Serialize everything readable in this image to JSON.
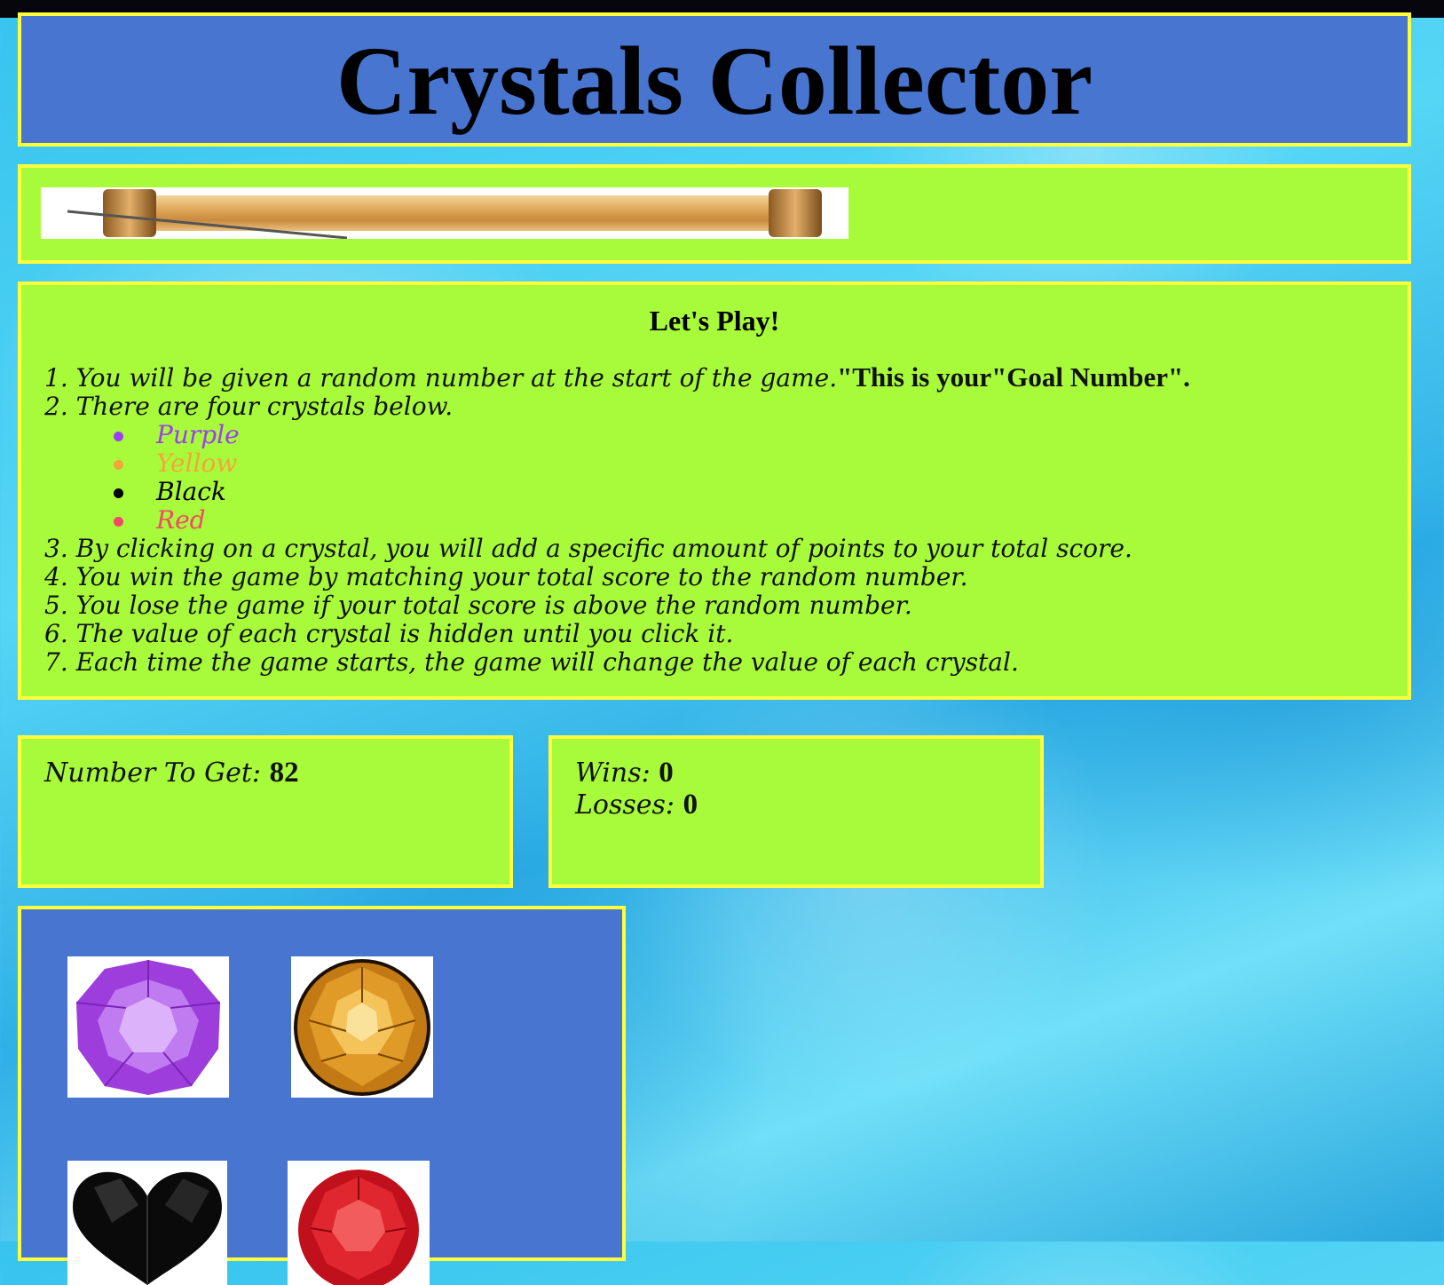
{
  "header": {
    "title": "Crystals Collector"
  },
  "instructions": {
    "heading": "Let's Play!",
    "rule1_text": "1. You will be given a random number at the start of the game.",
    "rule1_bold": "\"This is your\"Goal Number\".",
    "rule2_text": "2. There are four crystals below.",
    "colors": [
      {
        "label": "Purple",
        "color": "#9b3ff0"
      },
      {
        "label": "Yellow",
        "color": "#f5a53a"
      },
      {
        "label": "Black",
        "color": "#000000"
      },
      {
        "label": "Red",
        "color": "#f2486a"
      }
    ],
    "rules_after": [
      "3. By clicking on a crystal, you will add a specific amount of points to your total score.",
      "4. You win the game by matching your total score to the random number.",
      "5. You lose the game if your total score is above the random number.",
      "6. The value of each crystal is hidden until you click it.",
      "7. Each time the game starts, the game will change the value of each crystal."
    ]
  },
  "target": {
    "label": "Number To Get:",
    "value": "82"
  },
  "score": {
    "wins_label": "Wins:",
    "wins_value": "0",
    "losses_label": "Losses:",
    "losses_value": "0"
  },
  "crystals": [
    {
      "name": "purple-crystal-image"
    },
    {
      "name": "yellow-crystal-image"
    },
    {
      "name": "black-crystal-image"
    },
    {
      "name": "red-crystal-image"
    }
  ]
}
